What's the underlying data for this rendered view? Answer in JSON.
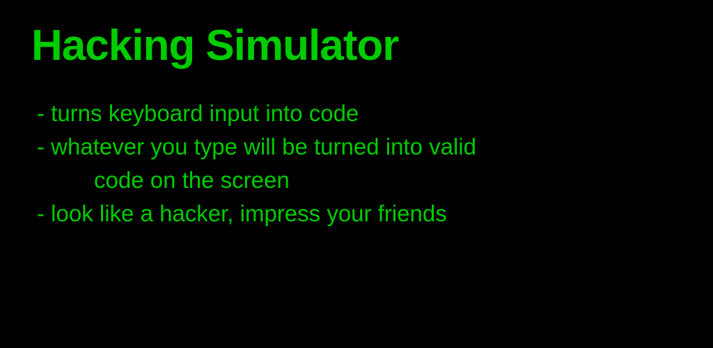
{
  "title": "Hacking Simulator",
  "bullets": {
    "item1": "- turns keyboard input into code",
    "item2_line1": "- whatever you type will be turned into valid",
    "item2_line2": "code on the screen",
    "item3": "- look like a hacker, impress your friends"
  },
  "colors": {
    "background": "#000000",
    "text": "#00cc00"
  }
}
